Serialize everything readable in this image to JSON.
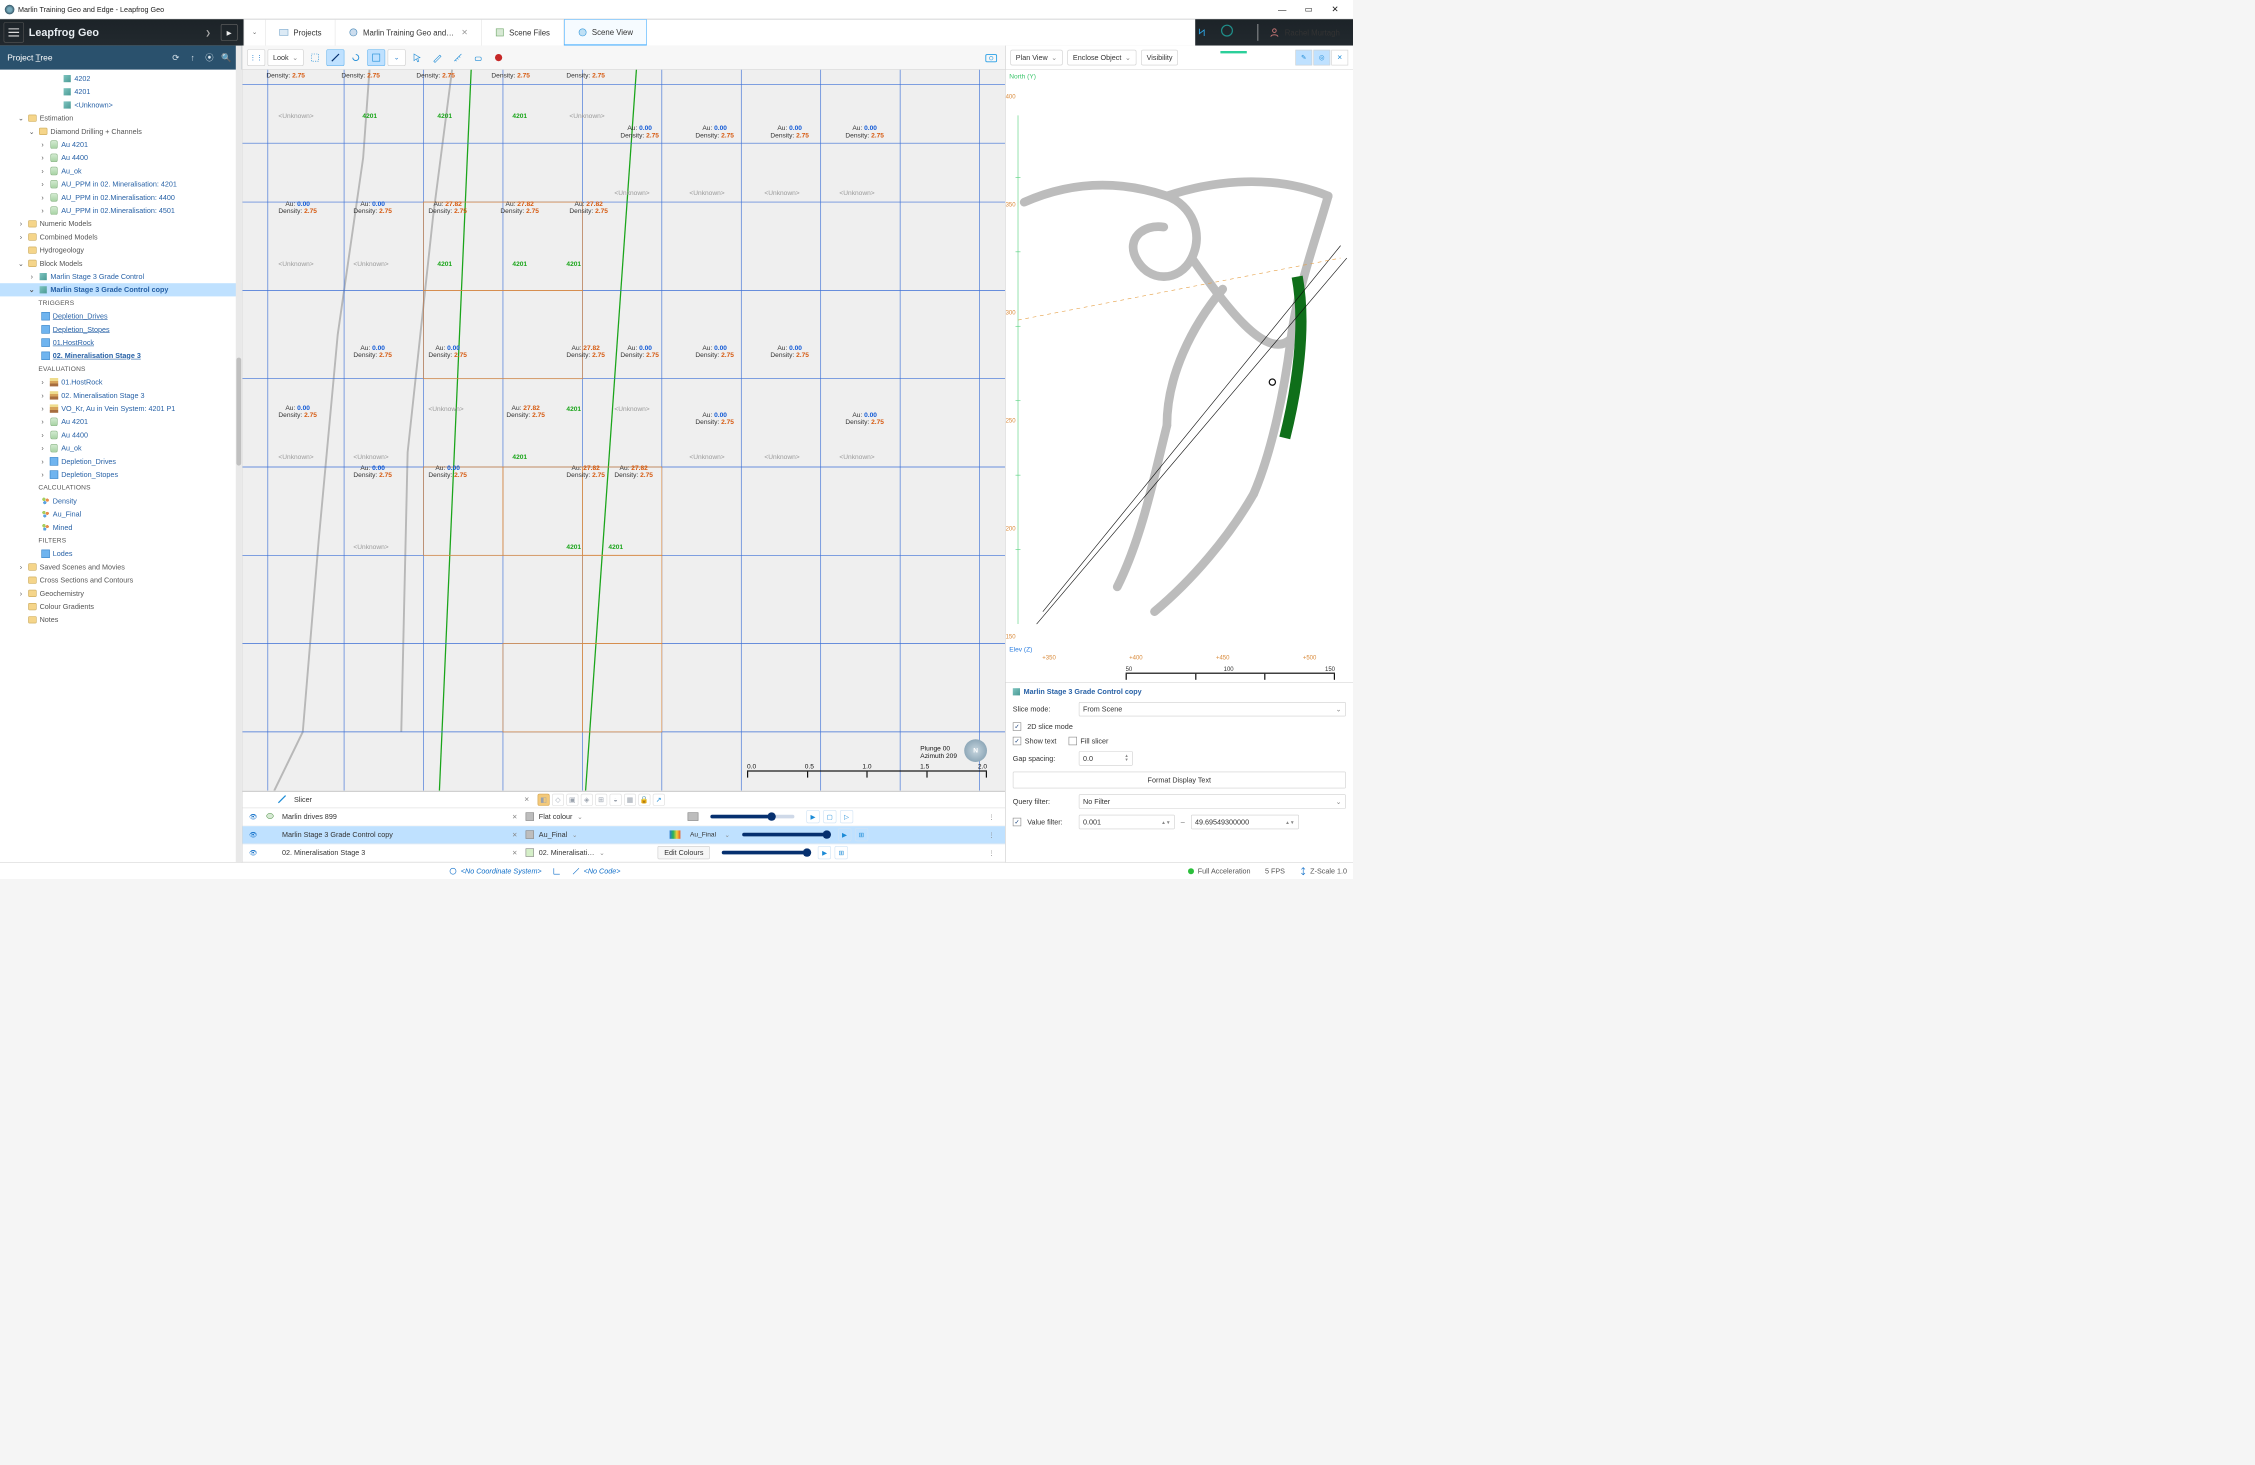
{
  "window": {
    "title": "Marlin Training Geo and Edge - Leapfrog Geo"
  },
  "brand": {
    "name": "Leapfrog Geo"
  },
  "tabs": {
    "projects": "Projects",
    "doc": "Marlin Training Geo and…",
    "scenefiles": "Scene Files",
    "sceneview": "Scene View"
  },
  "user": {
    "name": "Rachel Murtagh"
  },
  "treeheader": {
    "title_pre": "Project ",
    "title_u": "T",
    "title_post": "ree"
  },
  "tree": {
    "n4202": "4202",
    "n4201": "4201",
    "nUnknown": "<Unknown>",
    "estimation": "Estimation",
    "ddc": "Diamond Drilling + Channels",
    "au4201": "Au 4201",
    "au4400": "Au 4400",
    "auok": "Au_ok",
    "aup1": "AU_PPM in 02. Mineralisation: 4201",
    "aup2": "AU_PPM in 02.Mineralisation: 4400",
    "aup3": "AU_PPM in 02.Mineralisation: 4501",
    "nummodels": "Numeric Models",
    "combmodels": "Combined Models",
    "hydro": "Hydrogeology",
    "blockmodels": "Block Models",
    "marlin_s3": "Marlin Stage 3 Grade Control",
    "marlin_s3c": "Marlin Stage 3 Grade Control copy",
    "triggers": "TRIGGERS",
    "dep_drives": "Depletion_Drives",
    "dep_stopes": "Depletion_Stopes",
    "hostrock": "01.HostRock",
    "min_s3": "02. Mineralisation Stage 3",
    "evals": "EVALUATIONS",
    "e_hostrock": "01.HostRock",
    "e_min_s3": "02. Mineralisation Stage 3",
    "vo_kr": "VO_Kr, Au in Vein System: 4201 P1",
    "e_au4201": "Au 4201",
    "e_au4400": "Au 4400",
    "e_auok": "Au_ok",
    "e_depd": "Depletion_Drives",
    "e_deps": "Depletion_Stopes",
    "calcs": "CALCULATIONS",
    "c_density": "Density",
    "c_aufinal": "Au_Final",
    "c_mined": "Mined",
    "filters": "FILTERS",
    "f_lodes": "Lodes",
    "savedscenes": "Saved Scenes and Movies",
    "xsections": "Cross Sections and Contours",
    "geochem": "Geochemistry",
    "gradients": "Colour Gradients",
    "notes": "Notes"
  },
  "toolbar": {
    "look": "Look"
  },
  "blockmodel": {
    "density_label": "Density:",
    "au_label": "Au:",
    "d_val": "2.75",
    "au_zero": "0.00",
    "au_hi": "27.82",
    "zone": "4201",
    "unknown": "<Unknown>"
  },
  "plunge": {
    "l1": "Plunge 00",
    "l2": "Azimuth 209"
  },
  "scale": {
    "t0": "0.0",
    "t1": "0.5",
    "t2": "1.0",
    "t3": "1.5",
    "t4": "2.0"
  },
  "scenelist": {
    "slicer": "Slicer",
    "row1": "Marlin drives 899",
    "row2": "Marlin Stage 3 Grade Control copy",
    "row3": "02. Mineralisation Stage 3",
    "flat": "Flat colour",
    "aufinal": "Au_Final",
    "aufinal2": "Au_Final",
    "min": "02. Mineralisati…",
    "edit": "Edit Colours"
  },
  "rview": {
    "plan": "Plan View",
    "enclose": "Enclose Object",
    "visibility": "Visibility",
    "north": "North (Y)",
    "elev": "Elev (Z)",
    "xticks": [
      "+350",
      "+400",
      "+450",
      "+500"
    ],
    "xticks2": [
      "50",
      "100",
      "150"
    ],
    "yticks": [
      "400",
      "350",
      "300",
      "250",
      "200",
      "150"
    ]
  },
  "props": {
    "title": "Marlin Stage 3 Grade Control copy",
    "slice_mode": "Slice mode:",
    "slice_val": "From Scene",
    "cb_2d": "2D slice mode",
    "cb_text": "Show text",
    "cb_fill": "Fill slicer",
    "gap": "Gap spacing:",
    "gap_val": "0.0",
    "format_btn": "Format Display Text",
    "qfilter": "Query filter:",
    "qfilter_val": "No Filter",
    "vfilter": "Value filter:",
    "vmin": "0.001",
    "vmax": "49.69549300000"
  },
  "status": {
    "coord": "<No Coordinate System>",
    "nocode": "<No Code>",
    "accel": "Full Acceleration",
    "fps": "5 FPS",
    "zscale": "Z-Scale 1.0"
  }
}
